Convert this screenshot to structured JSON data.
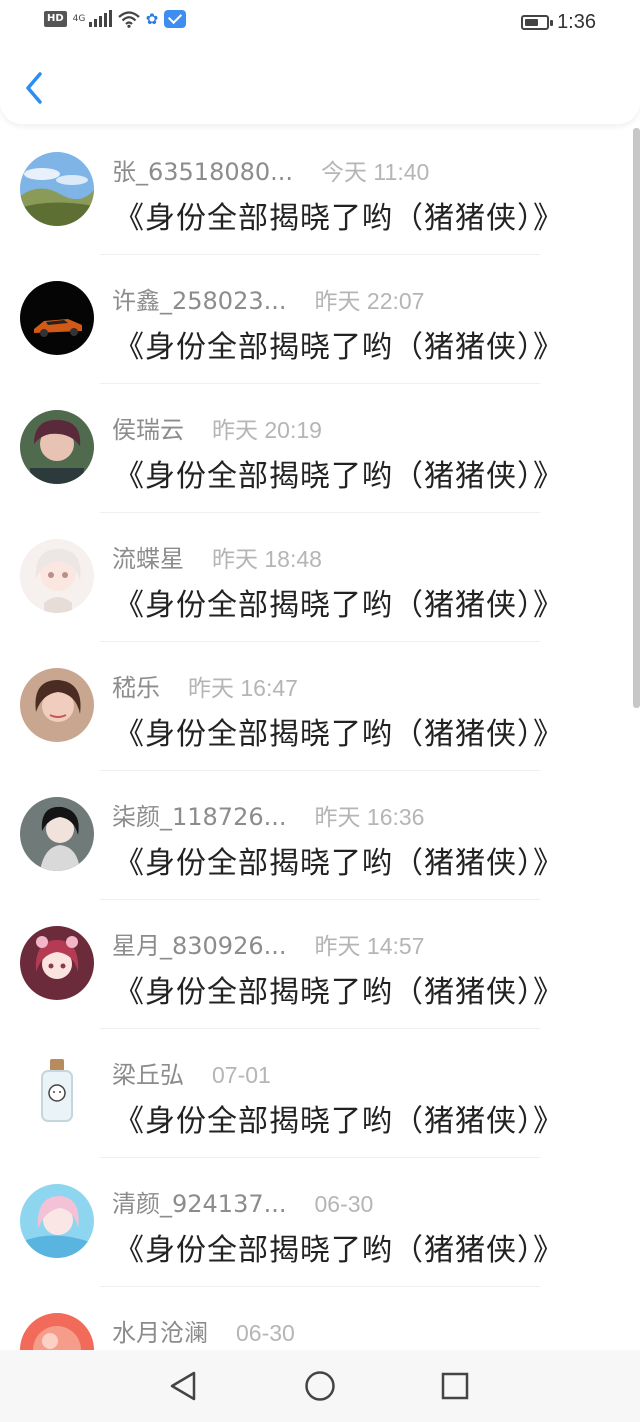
{
  "status_bar": {
    "network_badge": "HD",
    "network_type": "4G",
    "time": "1:36",
    "battery_level": 0.65
  },
  "header": {
    "back_icon": "chevron-left-icon",
    "accent_color": "#2a8ff0"
  },
  "items": [
    {
      "name": "张_63518080...",
      "time": "今天 11:40",
      "title": "《身份全部揭晓了哟（猪猪侠）》",
      "avatar": "landscape"
    },
    {
      "name": "许鑫_258023...",
      "time": "昨天 22:07",
      "title": "《身份全部揭晓了哟（猪猪侠）》",
      "avatar": "car"
    },
    {
      "name": "侯瑞云",
      "time": "昨天 20:19",
      "title": "《身份全部揭晓了哟（猪猪侠）》",
      "avatar": "boy"
    },
    {
      "name": "流蝶星",
      "time": "昨天 18:48",
      "title": "《身份全部揭晓了哟（猪猪侠）》",
      "avatar": "anime-white"
    },
    {
      "name": "嵇乐",
      "time": "昨天 16:47",
      "title": "《身份全部揭晓了哟（猪猪侠）》",
      "avatar": "girl"
    },
    {
      "name": "柒颜_118726...",
      "time": "昨天 16:36",
      "title": "《身份全部揭晓了哟（猪猪侠）》",
      "avatar": "dark-girl"
    },
    {
      "name": "星月_830926...",
      "time": "昨天 14:57",
      "title": "《身份全部揭晓了哟（猪猪侠）》",
      "avatar": "anime-red"
    },
    {
      "name": "梁丘弘",
      "time": "07-01",
      "title": "《身份全部揭晓了哟（猪猪侠）》",
      "avatar": "bottle"
    },
    {
      "name": "清颜_924137...",
      "time": "06-30",
      "title": "《身份全部揭晓了哟（猪猪侠）》",
      "avatar": "anime-blue"
    },
    {
      "name": "水月沧澜",
      "time": "06-30",
      "title": "",
      "avatar": "red-ball"
    }
  ],
  "nav_bar": {
    "back": "triangle-back-icon",
    "home": "circle-home-icon",
    "recents": "square-recents-icon"
  }
}
